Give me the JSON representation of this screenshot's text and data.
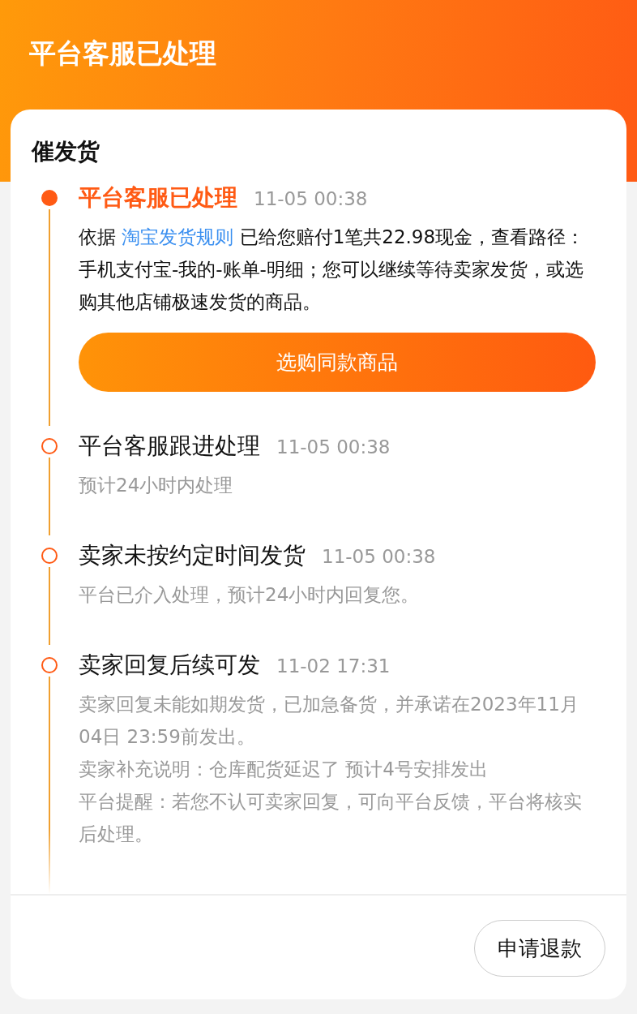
{
  "header": {
    "title": "平台客服已处理"
  },
  "card": {
    "title": "催发货",
    "events": [
      {
        "title": "平台客服已处理",
        "time": "11-05 00:38",
        "current": true,
        "prefix": "依据",
        "link": "淘宝发货规则",
        "lines": [
          "已给您赔付1笔共22.98现金，查看路径：手机支付宝-我的-账单-明细；您可以继续等待卖家发货，或选购其他店铺极速发货的商品。"
        ],
        "action": "选购同款商品"
      },
      {
        "title": "平台客服跟进处理",
        "time": "11-05 00:38",
        "current": false,
        "lines": [
          "预计24小时内处理"
        ]
      },
      {
        "title": "卖家未按约定时间发货",
        "time": "11-05 00:38",
        "current": false,
        "lines": [
          "平台已介入处理，预计24小时内回复您。"
        ]
      },
      {
        "title": "卖家回复后续可发",
        "time": "11-02 17:31",
        "current": false,
        "lines": [
          "卖家回复未能如期发货，已加急备货，并承诺在2023年11月04日 23:59前发出。",
          "卖家补充说明：仓库配货延迟了 预计4号安排发出",
          "平台提醒：若您不认可卖家回复，可向平台反馈，平台将核实后处理。"
        ]
      }
    ]
  },
  "footer": {
    "button": "申请退款"
  }
}
